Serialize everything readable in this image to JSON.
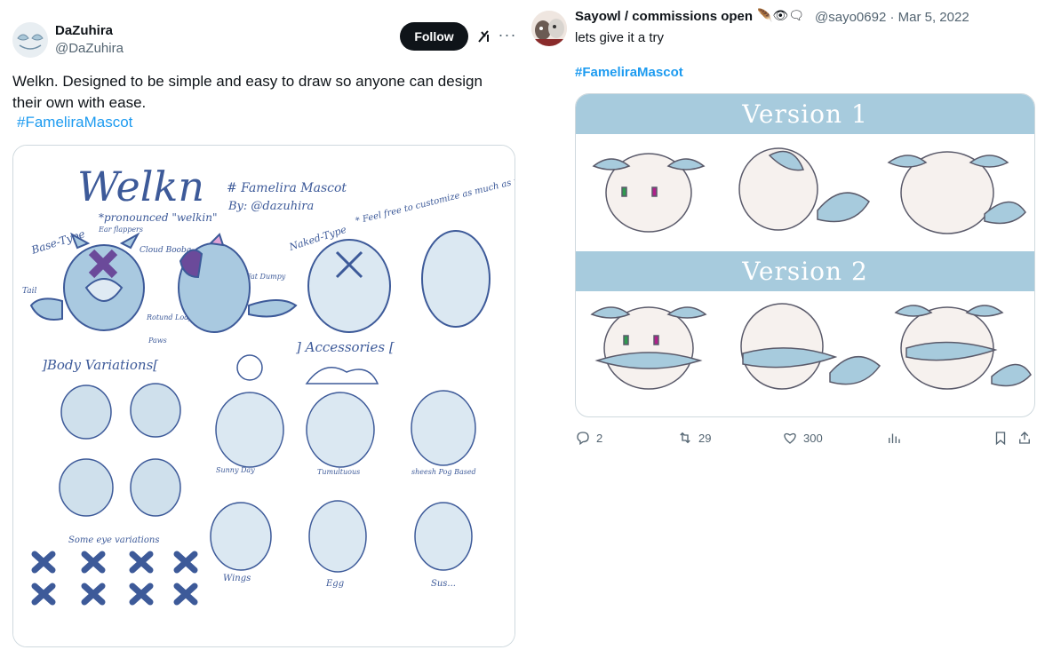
{
  "left_tweet": {
    "author_name": "DaZuhira",
    "author_handle": "@DaZuhira",
    "follow_label": "Follow",
    "more_label": "···",
    "text": "Welkn. Designed to be simple and easy to draw so anyone can design their own with ease.",
    "hashtag": "#FameliraMascot",
    "media": {
      "title": "Welkn",
      "subtitle": "# Famelira Mascot",
      "byline": "By: @dazuhira",
      "pronunciation": "*pronounced \"welkin\"",
      "feel_free": "* Feel free to customize as much as you like! *",
      "base_type": "Base-Type",
      "ear_flappers": "Ear flappers",
      "cloud_booba": "Cloud Booba",
      "tail": "Tail",
      "rotund_loaf": "Rotund Loaf",
      "paws": "Paws",
      "fat_dumpy": "Fat Dumpy",
      "naked_type": "Naked-Type",
      "body_variations": "]Body Variations[",
      "accessories": "] Accessories [",
      "sunny_day": "Sunny Day",
      "tumultuous": "Tumultuous",
      "sheesh": "sheesh Pog Based",
      "eye_variations": "Some eye variations",
      "wings": "Wings",
      "egg": "Egg",
      "sus": "Sus..."
    }
  },
  "right_tweet": {
    "author_name": "Sayowl / commissions open",
    "emojis": "🪶👁🗨",
    "author_handle": "@sayo0692",
    "date": "Mar 5, 2022",
    "separator": "·",
    "text": "lets give it a try",
    "hashtag": "#FameliraMascot",
    "media": {
      "version1": "Version 1",
      "version2": "Version 2"
    },
    "actions": {
      "replies": "2",
      "retweets": "29",
      "likes": "300"
    }
  },
  "colors": {
    "link": "#1d9bf0",
    "secondary_text": "#536471",
    "banner": "#a7cbdd",
    "sketch_line": "#3d5a99",
    "sketch_fill": "#bcd6e6",
    "sketch_purple": "#6b4a9a"
  }
}
